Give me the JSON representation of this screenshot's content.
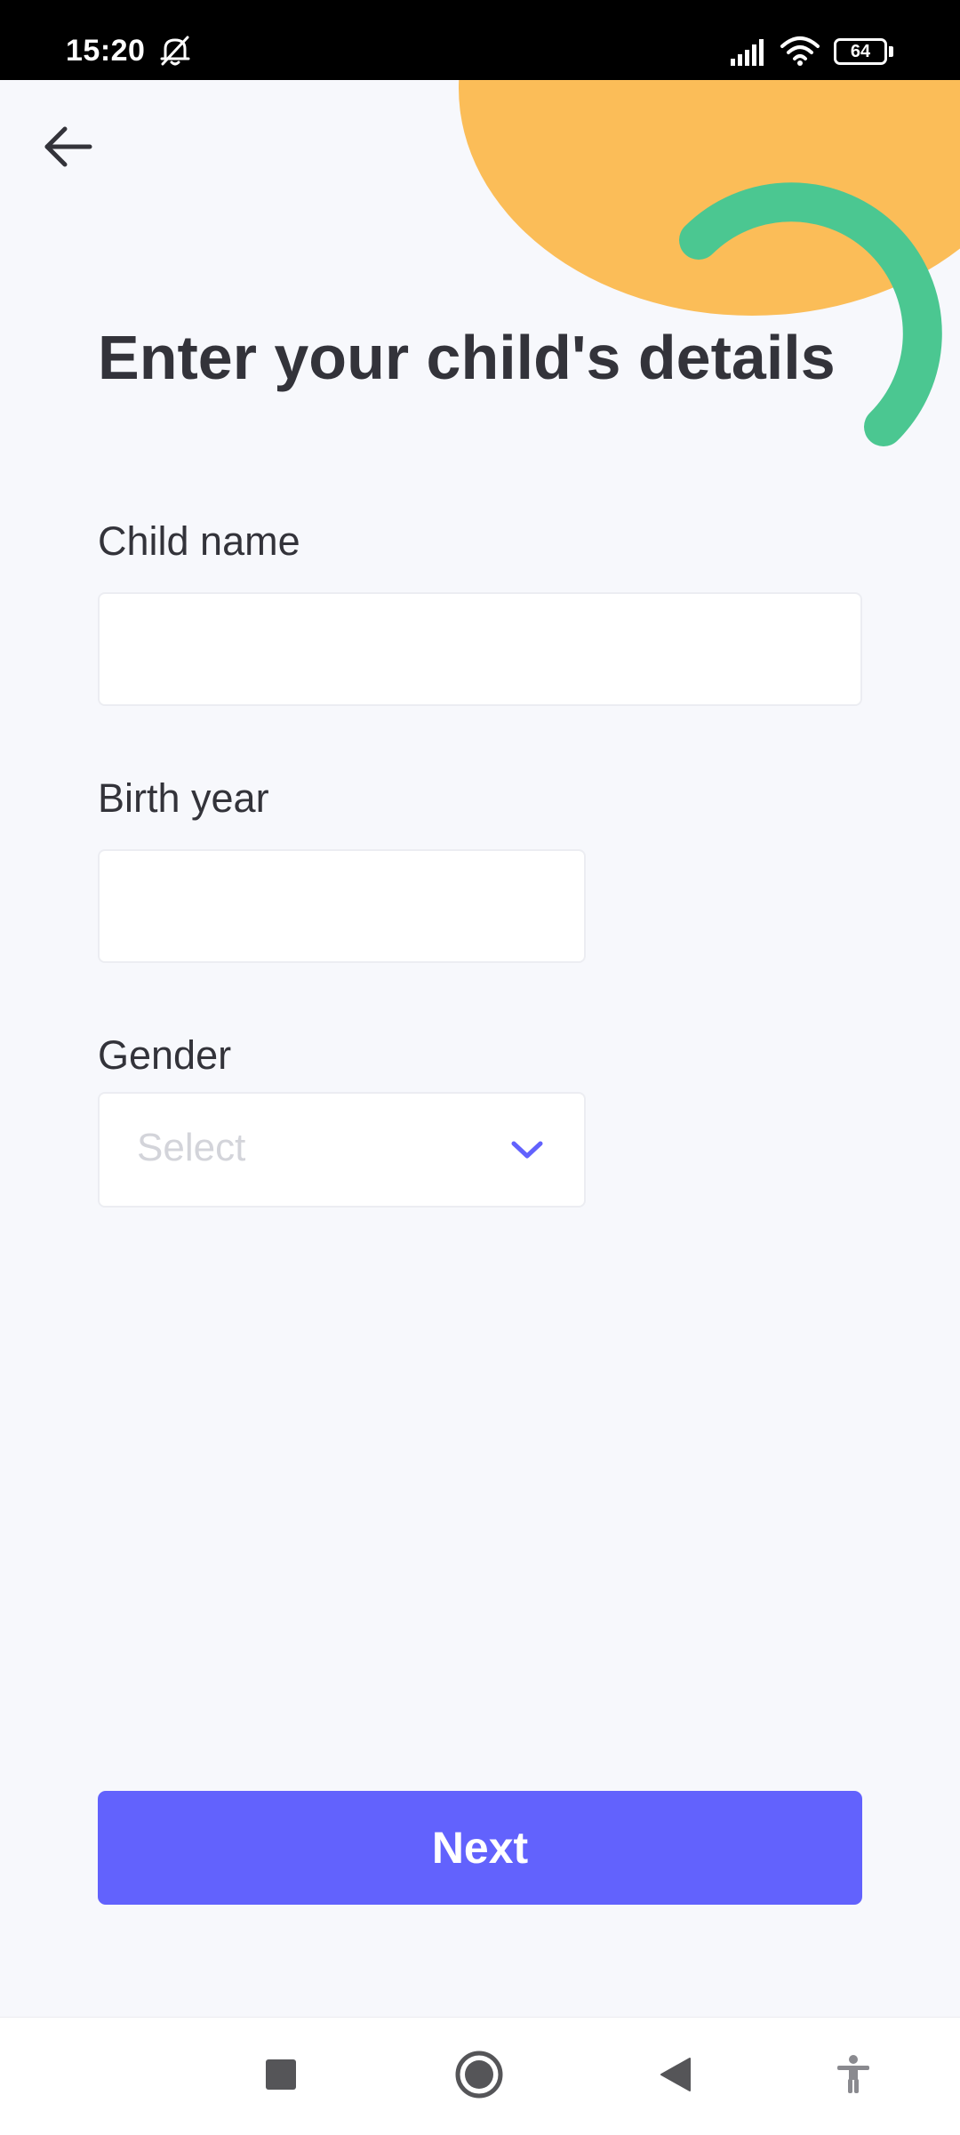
{
  "status_bar": {
    "time": "15:20",
    "icons": [
      "bell-off-icon",
      "signal-icon",
      "wifi-icon",
      "battery-icon"
    ],
    "battery_level": "64"
  },
  "header": {
    "back_icon": "arrow-left-icon"
  },
  "main": {
    "title": "Enter your child's details",
    "fields": {
      "child_name": {
        "label": "Child name",
        "value": "",
        "placeholder": ""
      },
      "birth_year": {
        "label": "Birth year",
        "value": "",
        "placeholder": ""
      },
      "gender": {
        "label": "Gender",
        "selected": "Select",
        "icon": "chevron-down-icon"
      }
    },
    "next_button": "Next"
  },
  "nav_bar": {
    "items": [
      "recents-square-icon",
      "home-circle-icon",
      "back-triangle-icon",
      "accessibility-icon"
    ]
  },
  "colors": {
    "background": "#f7f8fc",
    "accent": "#6262fd",
    "decor_yellow": "#fbbd58",
    "decor_green": "#4bc791",
    "text": "#33333a",
    "placeholder": "#d3d4da"
  }
}
